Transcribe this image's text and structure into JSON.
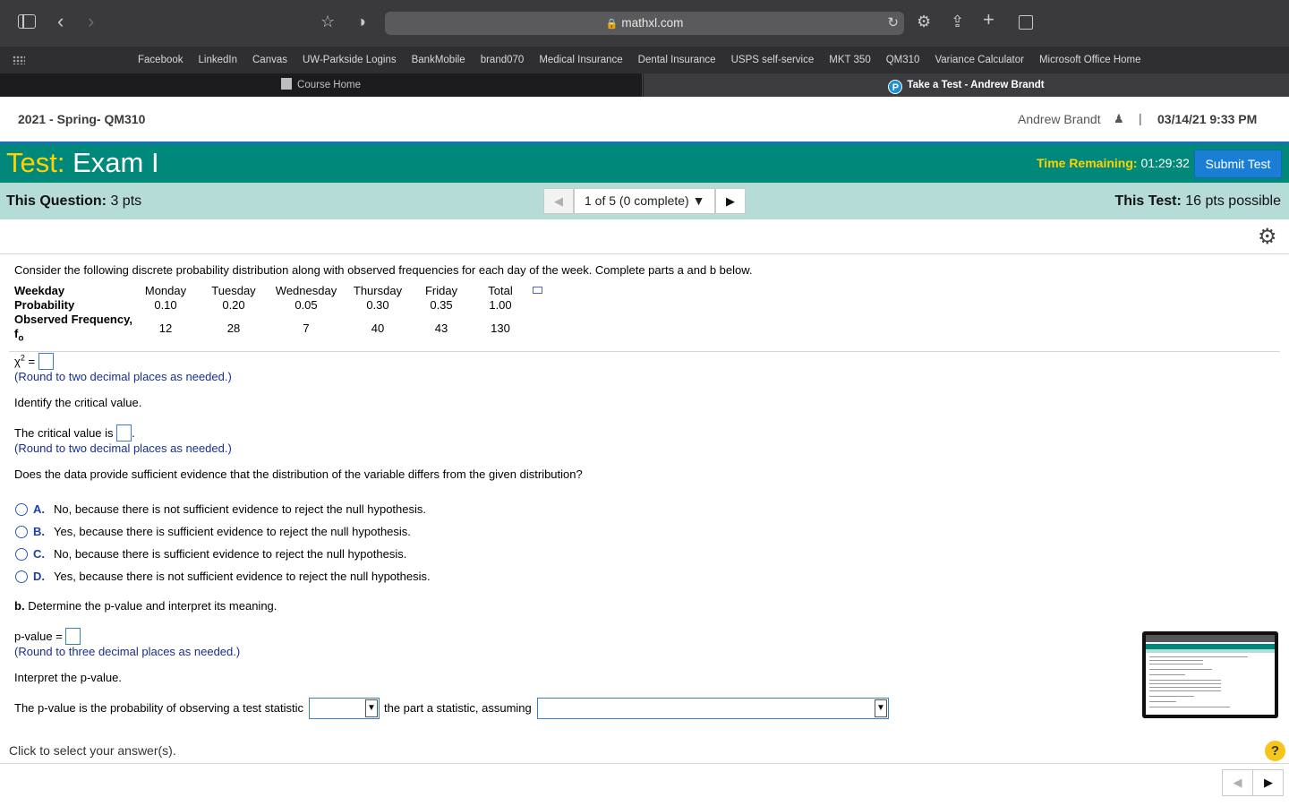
{
  "browser": {
    "url": "mathxl.com",
    "bookmarks": [
      "Facebook",
      "LinkedIn",
      "Canvas",
      "UW-Parkside Logins",
      "BankMobile",
      "brand070",
      "Medical Insurance",
      "Dental Insurance",
      "USPS self-service",
      "MKT 350",
      "QM310",
      "Variance Calculator",
      "Microsoft Office Home"
    ],
    "tabs": [
      {
        "label": "Course Home",
        "active": false
      },
      {
        "label": "Take a Test - Andrew Brandt",
        "active": true
      }
    ]
  },
  "header": {
    "course": "2021 - Spring- QM310",
    "user": "Andrew Brandt",
    "separator": "|",
    "datetime": "03/14/21 9:33 PM"
  },
  "test": {
    "label": "Test:",
    "name": "Exam I",
    "time_label": "Time Remaining:",
    "time_value": "01:29:32",
    "submit_label": "Submit Test"
  },
  "question_bar": {
    "this_question_label": "This Question:",
    "this_question_pts": "3 pts",
    "nav_label": "1 of 5 (0 complete)",
    "this_test_label": "This Test:",
    "this_test_pts": "16 pts possible"
  },
  "question": {
    "intro": "Consider the following discrete probability distribution along with observed frequencies for each day of the week. Complete parts a and b below.",
    "table": {
      "row_headers": [
        "Weekday",
        "Probability",
        "Observed Frequency,",
        "f"
      ],
      "f_subscript": "o",
      "days": [
        "Monday",
        "Tuesday",
        "Wednesday",
        "Thursday",
        "Friday",
        "Total"
      ],
      "probabilities": [
        "0.10",
        "0.20",
        "0.05",
        "0.30",
        "0.35",
        "1.00"
      ],
      "frequencies": [
        "12",
        "28",
        "7",
        "40",
        "43",
        "130"
      ]
    },
    "chi_label": "χ",
    "chi_sup": "2",
    "chi_eq": " =",
    "round2": "(Round to two decimal places as needed.)",
    "identify": "Identify the critical value.",
    "critical_prefix": "The critical value is",
    "critical_suffix": ".",
    "round2b": "(Round to two decimal places as needed.)",
    "sufficient_q": "Does the data provide sufficient evidence that the distribution of the variable differs from the given distribution?",
    "options": [
      {
        "letter": "A.",
        "text": "No, because there is not sufficient evidence to reject the null hypothesis."
      },
      {
        "letter": "B.",
        "text": "Yes, because there is sufficient evidence to reject the null hypothesis."
      },
      {
        "letter": "C.",
        "text": "No, because there is sufficient evidence to reject the null hypothesis."
      },
      {
        "letter": "D.",
        "text": "Yes, because there is not sufficient evidence to reject the null hypothesis."
      }
    ],
    "part_b_label": "b.",
    "part_b_text": "Determine the p-value and interpret its meaning.",
    "pvalue_label": "p-value =",
    "round3": "(Round to three decimal places as needed.)",
    "interpret": "Interpret the p-value.",
    "sentence_1": "The p-value is the probability of observing a test statistic",
    "sentence_2": "the part a statistic, assuming"
  },
  "footer": {
    "instruction": "Click to select your answer(s).",
    "help": "?"
  }
}
